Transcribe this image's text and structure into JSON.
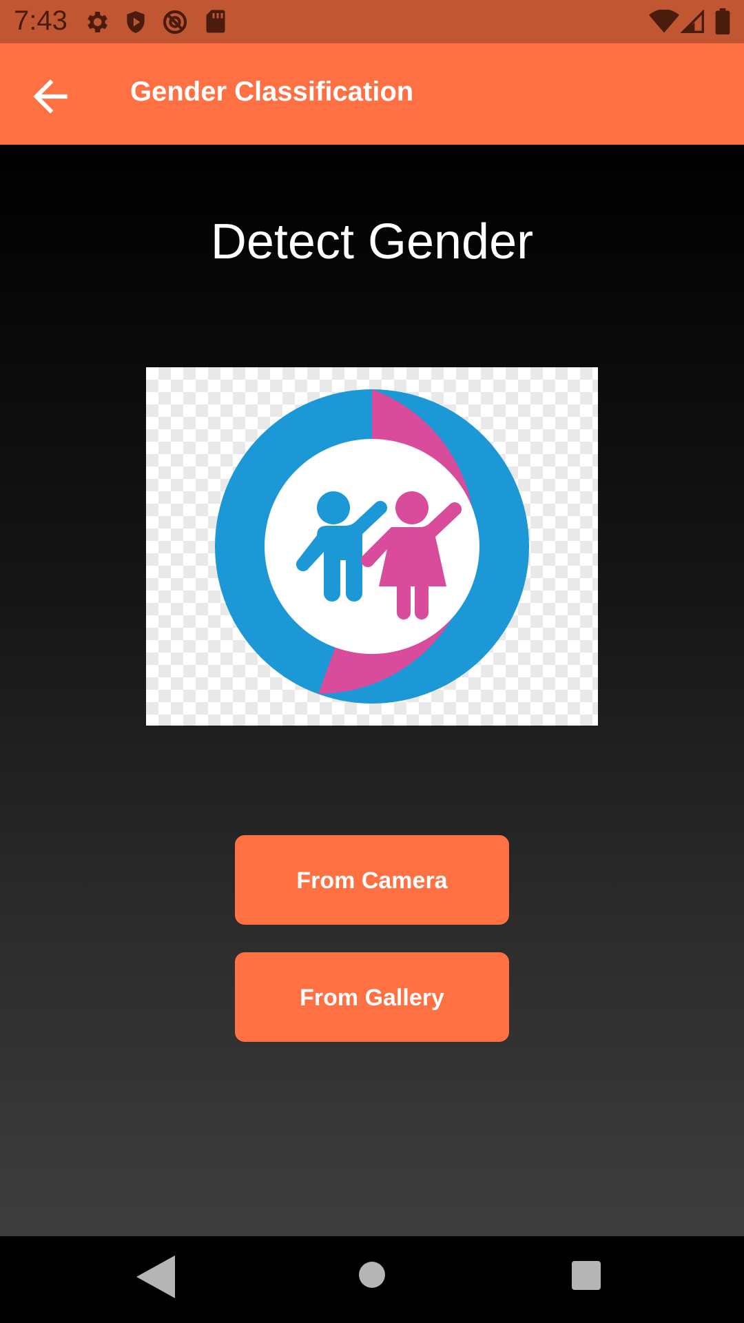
{
  "status_bar": {
    "time": "7:43",
    "left_icons": [
      "settings-icon",
      "shield-play-icon",
      "no-location-icon",
      "sd-card-icon"
    ],
    "right_icons": [
      "wifi-icon",
      "cell-signal-icon",
      "battery-icon"
    ]
  },
  "app_bar": {
    "title": "Gender Classification",
    "back_icon": "arrow-back-icon",
    "color": "#ff7043"
  },
  "main": {
    "heading": "Detect Gender",
    "image": {
      "semantic": "gender-classification-logo",
      "colors": {
        "male": "#1b98d5",
        "female": "#d94c9c"
      }
    },
    "buttons": {
      "camera_label": "From Camera",
      "gallery_label": "From Gallery"
    }
  },
  "nav_bar": {
    "icons": [
      "back-triangle-icon",
      "home-circle-icon",
      "recents-square-icon"
    ]
  }
}
